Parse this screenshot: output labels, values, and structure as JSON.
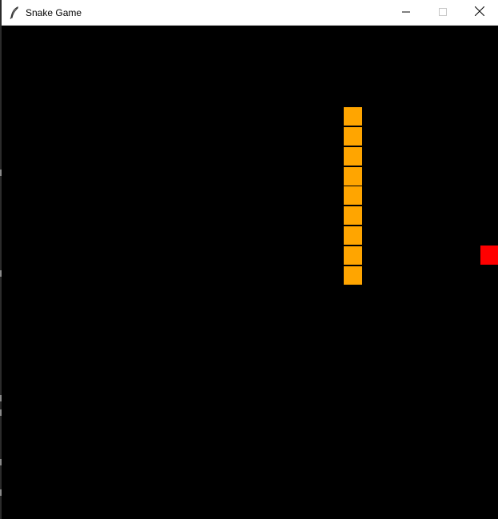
{
  "window": {
    "title": "Snake Game",
    "icon": "feather-icon"
  },
  "controls": {
    "minimize_icon": "minimize-icon",
    "maximize_icon": "maximize-icon",
    "close_icon": "close-icon"
  },
  "game": {
    "grid_cell_px_hint": "25",
    "background_color": "#000000",
    "snake_color": "#FFA500",
    "snake_outline_color": "#000000",
    "food_color": "#FF0000",
    "snake": [
      {
        "col": 17,
        "row": 4
      },
      {
        "col": 17,
        "row": 5
      },
      {
        "col": 17,
        "row": 6
      },
      {
        "col": 17,
        "row": 7
      },
      {
        "col": 17,
        "row": 8
      },
      {
        "col": 17,
        "row": 9
      },
      {
        "col": 17,
        "row": 10
      },
      {
        "col": 17,
        "row": 11
      },
      {
        "col": 17,
        "row": 12
      }
    ],
    "food": {
      "col": 24,
      "row": 11
    }
  }
}
